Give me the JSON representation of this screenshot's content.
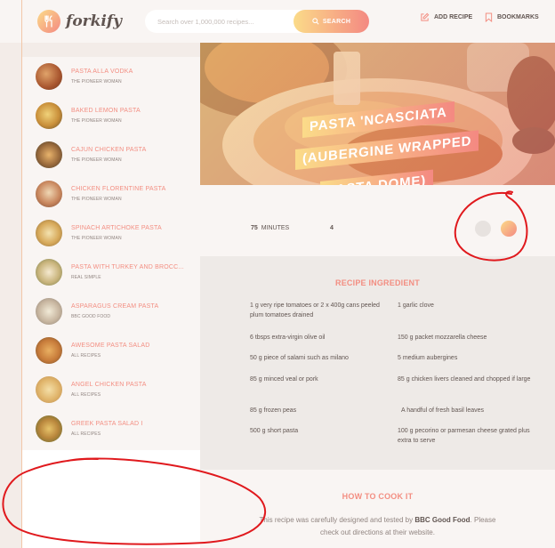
{
  "app": {
    "logo_text": "forkify"
  },
  "search": {
    "placeholder": "Search over 1,000,000 recipes...",
    "button_label": "SEARCH"
  },
  "nav": {
    "add_recipe": "ADD RECIPE",
    "bookmarks": "BOOKMARKS"
  },
  "results": [
    {
      "title": "PASTA ALLA VODKA",
      "publisher": "THE PIONEER WOMAN"
    },
    {
      "title": "BAKED LEMON PASTA",
      "publisher": "THE PIONEER WOMAN"
    },
    {
      "title": "CAJUN CHICKEN PASTA",
      "publisher": "THE PIONEER WOMAN"
    },
    {
      "title": "CHICKEN FLORENTINE PASTA",
      "publisher": "THE PIONEER WOMAN"
    },
    {
      "title": "SPINACH ARTICHOKE PASTA",
      "publisher": "THE PIONEER WOMAN"
    },
    {
      "title": "PASTA WITH TURKEY AND BROCC...",
      "publisher": "REAL SIMPLE"
    },
    {
      "title": "ASPARAGUS CREAM PASTA",
      "publisher": "BBC GOOD FOOD"
    },
    {
      "title": "AWESOME PASTA SALAD",
      "publisher": "ALL RECIPES"
    },
    {
      "title": "ANGEL CHICKEN PASTA",
      "publisher": "ALL RECIPES"
    },
    {
      "title": "GREEK PASTA SALAD I",
      "publisher": "ALL RECIPES"
    }
  ],
  "recipe": {
    "title_lines": [
      "PASTA 'NCASCIATA",
      "(AUBERGINE WRAPPED",
      "PASTA DOME)"
    ],
    "cooking_time": "75",
    "time_unit": "MINUTES",
    "servings": "4",
    "ingredients_title": "RECIPE INGREDIENT",
    "ingredients": [
      "1 g very ripe tomatoes or 2 x 400g cans peeled plum tomatoes drained",
      "1 garlic clove",
      "6 tbsps extra-virgin olive oil",
      "150 g packet mozzarella cheese",
      "50 g piece of salami such as milano",
      "5 medium aubergines",
      "85 g minced veal or pork",
      "85 g chicken livers cleaned and chopped if large",
      "85 g frozen peas",
      "A handful of fresh basil leaves",
      "500 g short pasta",
      "100 g pecorino or parmesan cheese grated plus extra to serve"
    ],
    "cook_title": "HOW TO COOK IT",
    "cook_text_1": "This recipe was carefully designed and tested by ",
    "cook_publisher": "BBC Good Food",
    "cook_text_2": ". Please",
    "cook_text_3": "check out directions at their website."
  },
  "colors": {
    "accent": "#f38e82",
    "gradient_start": "#fbdb89",
    "gradient_end": "#f48982",
    "annotation": "#e0191d"
  },
  "icons": {
    "logo": "fork-knife-icon",
    "search": "search-icon",
    "add": "edit-icon",
    "bookmark": "bookmark-icon"
  }
}
